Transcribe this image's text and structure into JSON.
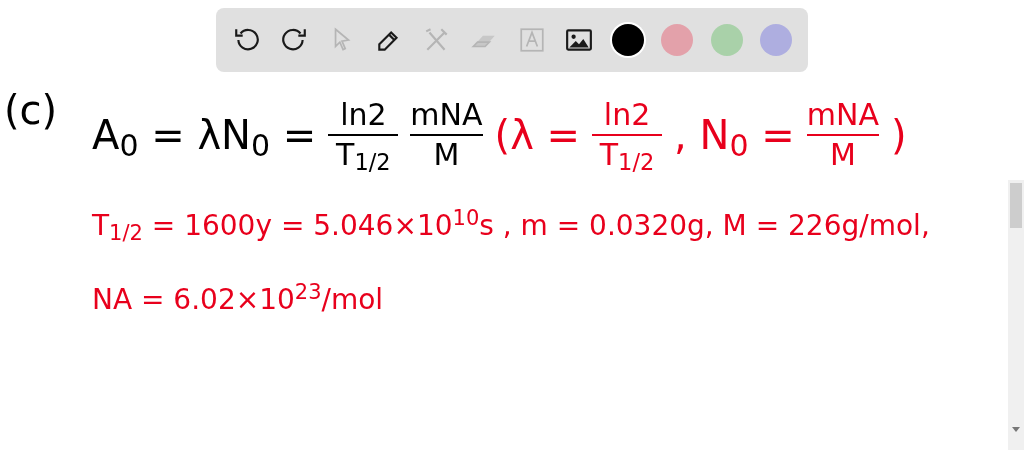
{
  "toolbar": {
    "tools": [
      {
        "kind": "undo",
        "disabled": false
      },
      {
        "kind": "redo",
        "disabled": false
      },
      {
        "kind": "pointer",
        "disabled": true
      },
      {
        "kind": "pen",
        "disabled": false
      },
      {
        "kind": "tools",
        "disabled": true
      },
      {
        "kind": "eraser",
        "disabled": true
      },
      {
        "kind": "text",
        "disabled": true
      },
      {
        "kind": "image",
        "disabled": false
      }
    ],
    "colors": [
      {
        "color": "#000000",
        "selected": true
      },
      {
        "color": "#e3a1aa",
        "selected": false
      },
      {
        "color": "#a9d1a9",
        "selected": false
      },
      {
        "color": "#aeaee0",
        "selected": false
      }
    ]
  },
  "board": {
    "label": "(c)",
    "lines": [
      {
        "segments": [
          {
            "kind": "text",
            "text": "A$_{0}$ = λN$_{0}$ =",
            "color": "#000000"
          },
          {
            "kind": "fraction",
            "numerator": "ln2",
            "denominator": "T$_{1/2}$",
            "color": "#000000"
          },
          {
            "kind": "fraction",
            "numerator": "mNA",
            "denominator": "M",
            "color": "#000000"
          },
          {
            "kind": "text",
            "text": "(λ =",
            "color": "#e8001c"
          },
          {
            "kind": "fraction",
            "numerator": "ln2",
            "denominator": "T$_{1/2}$",
            "color": "#e8001c"
          },
          {
            "kind": "text",
            "text": ", N$_{0}$ =",
            "color": "#e8001c"
          },
          {
            "kind": "fraction",
            "numerator": "mNA",
            "denominator": "M",
            "color": "#e8001c"
          },
          {
            "kind": "text",
            "text": ")",
            "color": "#e8001c"
          }
        ]
      },
      {
        "segments": [
          {
            "kind": "text",
            "text": "T$_{1/2}$ = 1600y = 5.046×10$^{10}$s , m = 0.0320g, M = 226g/mol,",
            "color": "#e8001c"
          }
        ]
      },
      {
        "segments": [
          {
            "kind": "text",
            "text": "NA = 6.02×10$^{23}$/mol",
            "color": "#e8001c"
          }
        ]
      }
    ]
  }
}
